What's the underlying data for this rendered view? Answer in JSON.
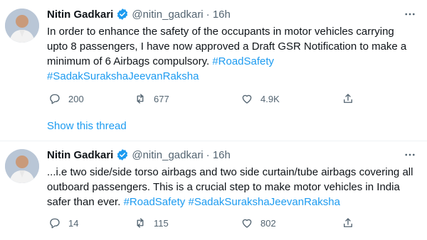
{
  "tweets": [
    {
      "author": "Nitin Gadkari",
      "handle": "@nitin_gadkari",
      "time": "· 16h",
      "text": "In order to enhance the safety of the occupants in motor vehicles carrying upto 8 passengers, I have now approved a Draft GSR Notification to make a minimum of 6 Airbags compulsory. ",
      "hashtags": [
        "#RoadSafety",
        "#SadakSurakshaJeevanRaksha"
      ],
      "replies": "200",
      "retweets": "677",
      "likes": "4.9K"
    },
    {
      "author": "Nitin Gadkari",
      "handle": "@nitin_gadkari",
      "time": "· 16h",
      "text": "...i.e two side/side torso airbags and two side curtain/tube airbags covering all outboard passengers. This is a crucial step to make motor vehicles in India safer than ever. ",
      "hashtags": [
        "#RoadSafety",
        "#SadakSurakshaJeevanRaksha"
      ],
      "replies": "14",
      "retweets": "115",
      "likes": "802"
    }
  ],
  "show_thread_label": "Show this thread",
  "colors": {
    "accent": "#1d9bf0",
    "muted": "#536471",
    "text": "#0f1419"
  },
  "icons": [
    "verified-badge-icon",
    "more-icon",
    "reply-icon",
    "retweet-icon",
    "like-icon",
    "share-icon"
  ]
}
